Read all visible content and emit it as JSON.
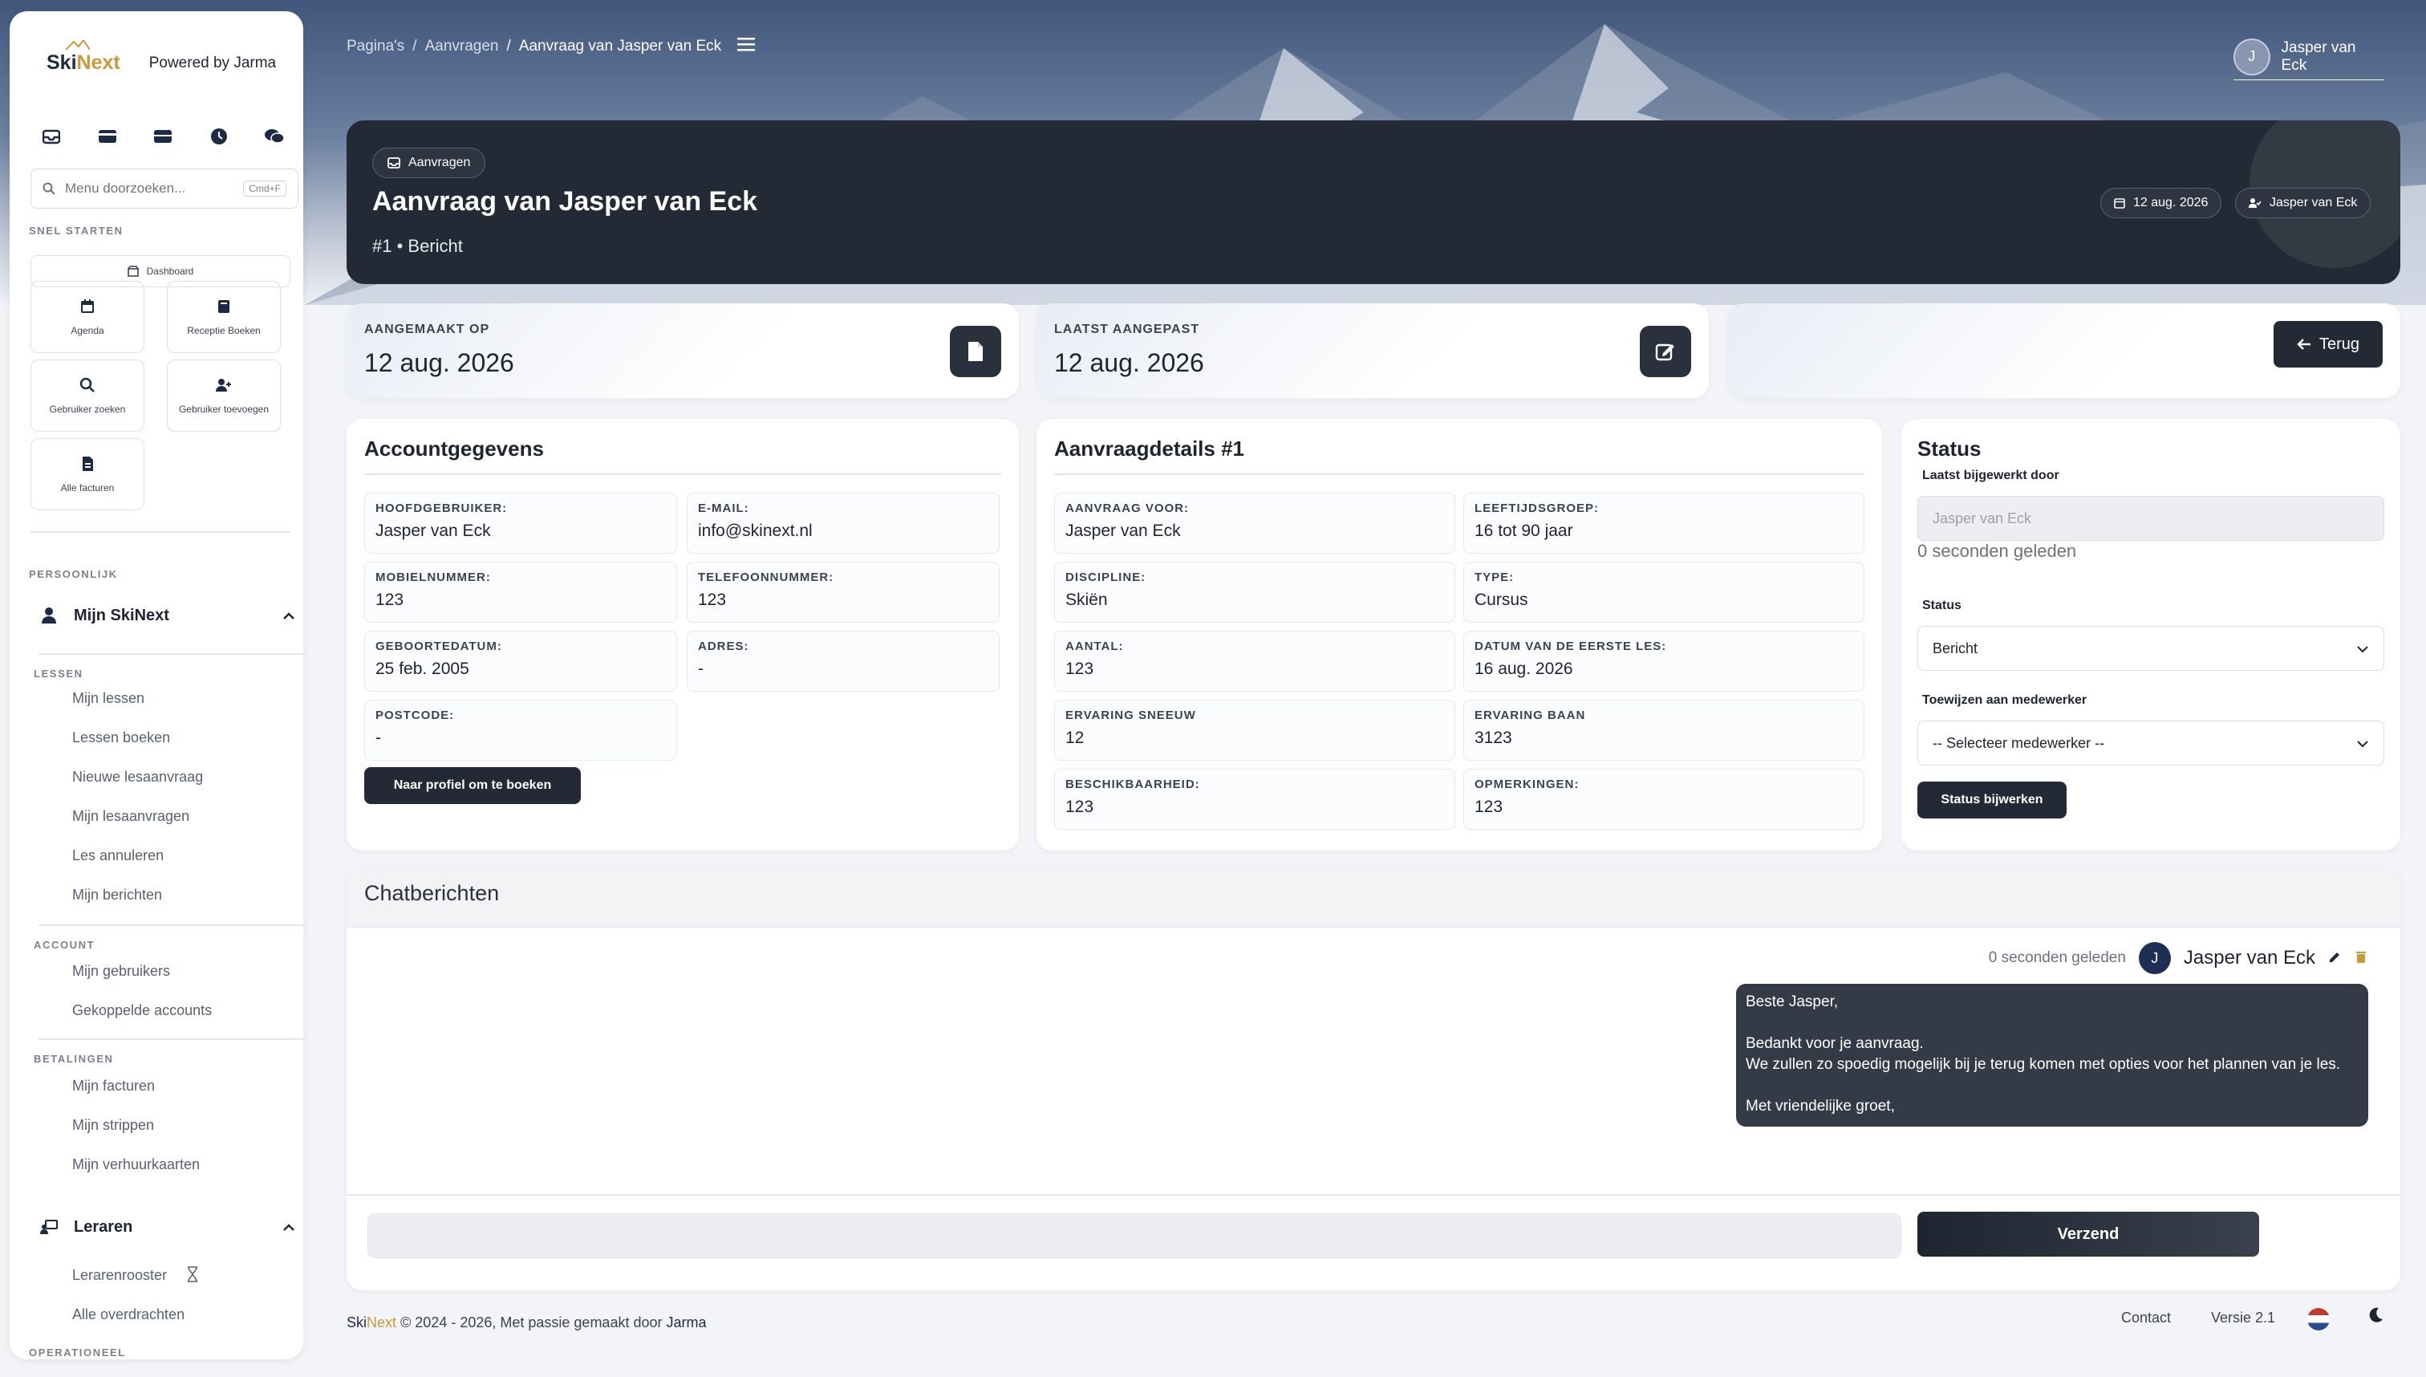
{
  "brand": {
    "logo_ski": "Ski",
    "logo_next": "Next",
    "powered": "Powered by Jarma"
  },
  "sidebar": {
    "search_placeholder": "Menu doorzoeken...",
    "search_shortcut": "Cmd+F",
    "quick_start_label": "SNEL STARTEN",
    "dashboard": "Dashboard",
    "tiles": [
      "Agenda",
      "Receptie Boeken",
      "Gebruiker zoeken",
      "Gebruiker toevoegen",
      "Alle facturen"
    ],
    "personal_label": "PERSOONLIJK",
    "my_skinext": "Mijn SkiNext",
    "lessons_label": "LESSEN",
    "lessons": [
      "Mijn lessen",
      "Lessen boeken",
      "Nieuwe lesaanvraag",
      "Mijn lesaanvragen",
      "Les annuleren",
      "Mijn berichten"
    ],
    "account_label": "ACCOUNT",
    "account": [
      "Mijn gebruikers",
      "Gekoppelde accounts"
    ],
    "payments_label": "BETALINGEN",
    "payments": [
      "Mijn facturen",
      "Mijn strippen",
      "Mijn verhuurkaarten"
    ],
    "teachers": "Leraren",
    "teacher_items": [
      "Lerarenrooster",
      "Alle overdrachten"
    ],
    "operational_label": "OPERATIONEEL"
  },
  "breadcrumb": {
    "root": "Pagina's",
    "parent": "Aanvragen",
    "current": "Aanvraag van Jasper van Eck"
  },
  "user": {
    "name": "Jasper van Eck",
    "initial": "J"
  },
  "header": {
    "pill": "Aanvragen",
    "title": "Aanvraag van Jasper van Eck",
    "subtitle": "#1 • Bericht",
    "date": "12 aug. 2026",
    "user": "Jasper van Eck"
  },
  "stats": {
    "created_label": "AANGEMAAKT OP",
    "created_value": "12 aug. 2026",
    "updated_label": "LAATST AANGEPAST",
    "updated_value": "12 aug. 2026",
    "back": "Terug"
  },
  "account": {
    "title": "Accountgegevens",
    "fields": [
      {
        "label": "HOOFDGEBRUIKER:",
        "value": "Jasper van Eck"
      },
      {
        "label": "E-MAIL:",
        "value": "info@skinext.nl"
      },
      {
        "label": "MOBIELNUMMER:",
        "value": "123"
      },
      {
        "label": "TELEFOONNUMMER:",
        "value": "123"
      },
      {
        "label": "GEBOORTEDATUM:",
        "value": "25 feb. 2005"
      },
      {
        "label": "ADRES:",
        "value": "-"
      },
      {
        "label": "POSTCODE:",
        "value": "-"
      }
    ],
    "profile_button": "Naar profiel om te boeken"
  },
  "details": {
    "title": "Aanvraagdetails #1",
    "fields": [
      {
        "label": "AANVRAAG VOOR:",
        "value": "Jasper van Eck"
      },
      {
        "label": "LEEFTIJDSGROEP:",
        "value": "16 tot 90 jaar"
      },
      {
        "label": "DISCIPLINE:",
        "value": "Skiën"
      },
      {
        "label": "TYPE:",
        "value": "Cursus"
      },
      {
        "label": "AANTAL:",
        "value": "123"
      },
      {
        "label": "DATUM VAN DE EERSTE LES:",
        "value": "16 aug. 2026"
      },
      {
        "label": "ERVARING SNEEUW",
        "value": "12"
      },
      {
        "label": "ERVARING BAAN",
        "value": "3123"
      },
      {
        "label": "BESCHIKBAARHEID:",
        "value": "123"
      },
      {
        "label": "OPMERKINGEN:",
        "value": "123"
      }
    ]
  },
  "status": {
    "title": "Status",
    "updated_by_label": "Laatst bijgewerkt door",
    "updated_by_value": "Jasper van Eck",
    "ago": "0 seconden geleden",
    "status_label": "Status",
    "status_value": "Bericht",
    "assign_label": "Toewijzen aan medewerker",
    "assign_value": "-- Selecteer medewerker --",
    "update_button": "Status bijwerken"
  },
  "chat": {
    "title": "Chatberichten",
    "time": "0 seconden geleden",
    "author": "Jasper van Eck",
    "author_initial": "J",
    "message": "Beste Jasper,\n\nBedankt voor je aanvraag.\nWe zullen zo spoedig mogelijk bij je terug komen met opties voor het plannen van je les.\n\nMet vriendelijke groet,",
    "input_value": "",
    "send": "Verzend"
  },
  "footer": {
    "ski": "Ski",
    "next": "Next",
    "text": " © 2024 - 2026, Met passie gemaakt door ",
    "author": "Jarma",
    "contact": "Contact",
    "version": "Versie 2.1"
  },
  "colors": {
    "dark": "#232a35",
    "accent": "#c99a3a",
    "brand_blue": "#1e2a44"
  }
}
